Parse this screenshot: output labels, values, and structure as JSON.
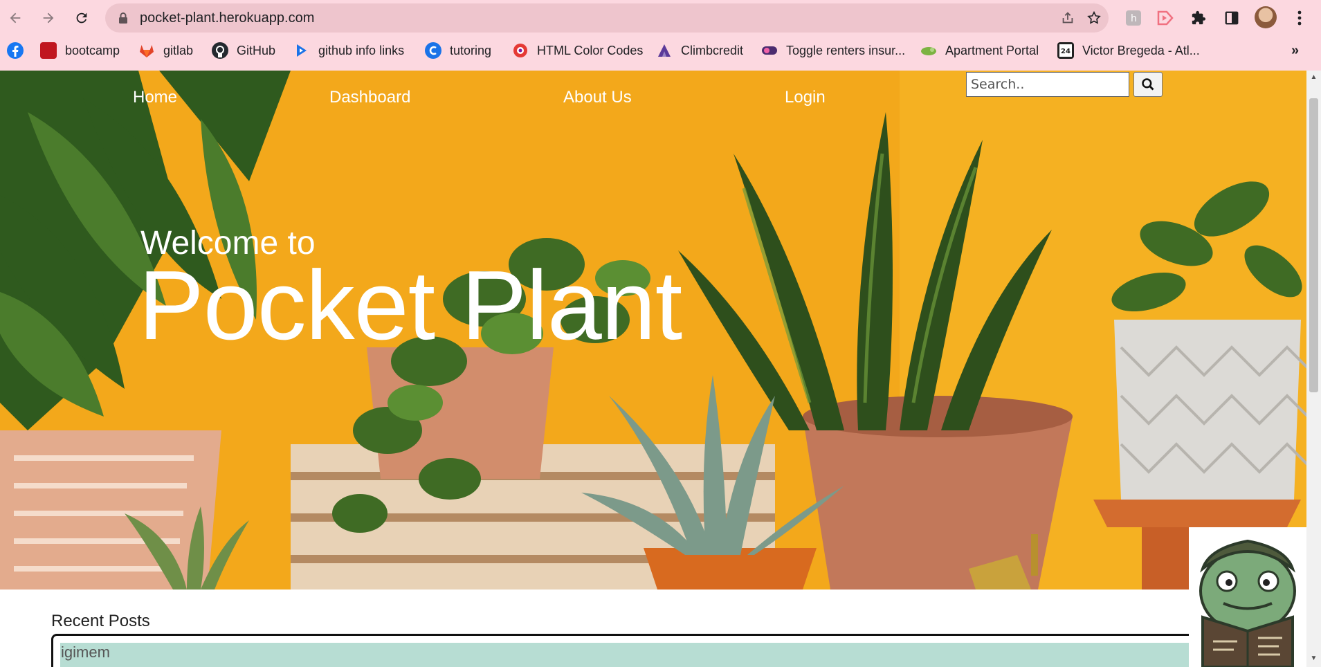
{
  "browser": {
    "url": "pocket-plant.herokuapp.com",
    "nav_icons": [
      "back-arrow-icon",
      "forward-arrow-icon",
      "reload-icon"
    ],
    "bookmarks": [
      {
        "label": "",
        "icon": "facebook-icon",
        "color": "#1877f2"
      },
      {
        "label": "bootcamp",
        "icon": "bootcamp-icon",
        "color": "#c0161f"
      },
      {
        "label": "gitlab",
        "icon": "gitlab-icon",
        "color": "#e24329"
      },
      {
        "label": "GitHub",
        "icon": "github-icon",
        "color": "#24292f"
      },
      {
        "label": "github info links",
        "icon": "blue-arrow-icon",
        "color": "#1a73e8"
      },
      {
        "label": "tutoring",
        "icon": "tutoring-icon",
        "color": "#1a73e8"
      },
      {
        "label": "HTML Color Codes",
        "icon": "color-wheel-icon",
        "color": "#e53935"
      },
      {
        "label": "Climbcredit",
        "icon": "climbcredit-icon",
        "color": "#5b3a99"
      },
      {
        "label": "Toggle renters insur...",
        "icon": "toggle-icon",
        "color": "#4b2c6f"
      },
      {
        "label": "Apartment Portal",
        "icon": "apartment-icon",
        "color": "#7cb342"
      },
      {
        "label": "Victor Bregeda - Atl...",
        "icon": "victor-icon",
        "color": "#222222"
      }
    ],
    "more": "»"
  },
  "site": {
    "nav": {
      "home": "Home",
      "dashboard": "Dashboard",
      "about": "About Us",
      "login": "Login"
    },
    "search": {
      "placeholder": "Search.."
    },
    "hero": {
      "welcome": "Welcome to",
      "title": "Pocket Plant"
    },
    "recent_posts": {
      "heading": "Recent Posts",
      "items": [
        {
          "title": "igimem"
        }
      ]
    }
  },
  "colors": {
    "chrome_bg": "#fcd8e0",
    "omnibox_bg": "#eec5cd",
    "hero_orange": "#f5b11e",
    "post_row_bg": "#b7ddd3"
  }
}
